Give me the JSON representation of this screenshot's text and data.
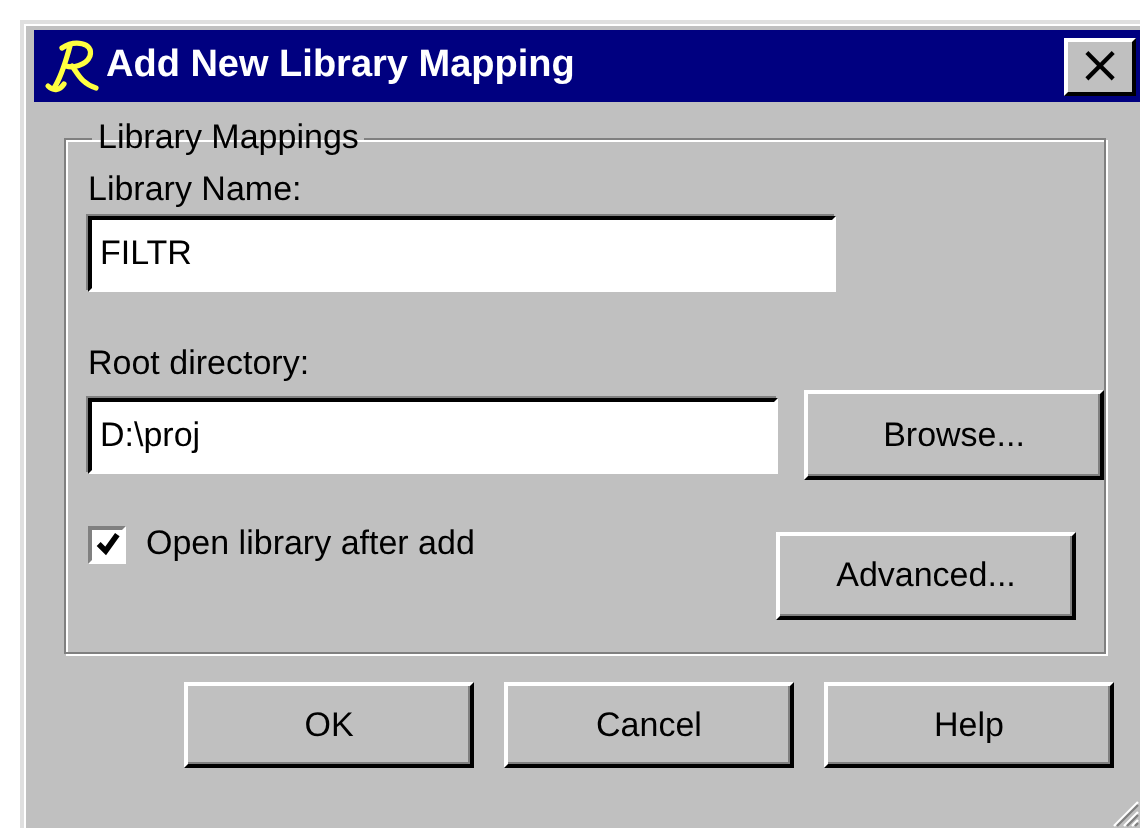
{
  "window": {
    "title": "Add New Library Mapping",
    "close": "×"
  },
  "group": {
    "title": "Library Mappings"
  },
  "library_name": {
    "label": "Library Name:",
    "value": "FILTR"
  },
  "root_directory": {
    "label": "Root directory:",
    "value": "D:\\proj",
    "button": "Browse..."
  },
  "open_after_add": {
    "label": "Open library after add",
    "checked": true
  },
  "advanced_button": "Advanced...",
  "buttons": [
    "OK",
    "Cancel",
    "Help"
  ]
}
